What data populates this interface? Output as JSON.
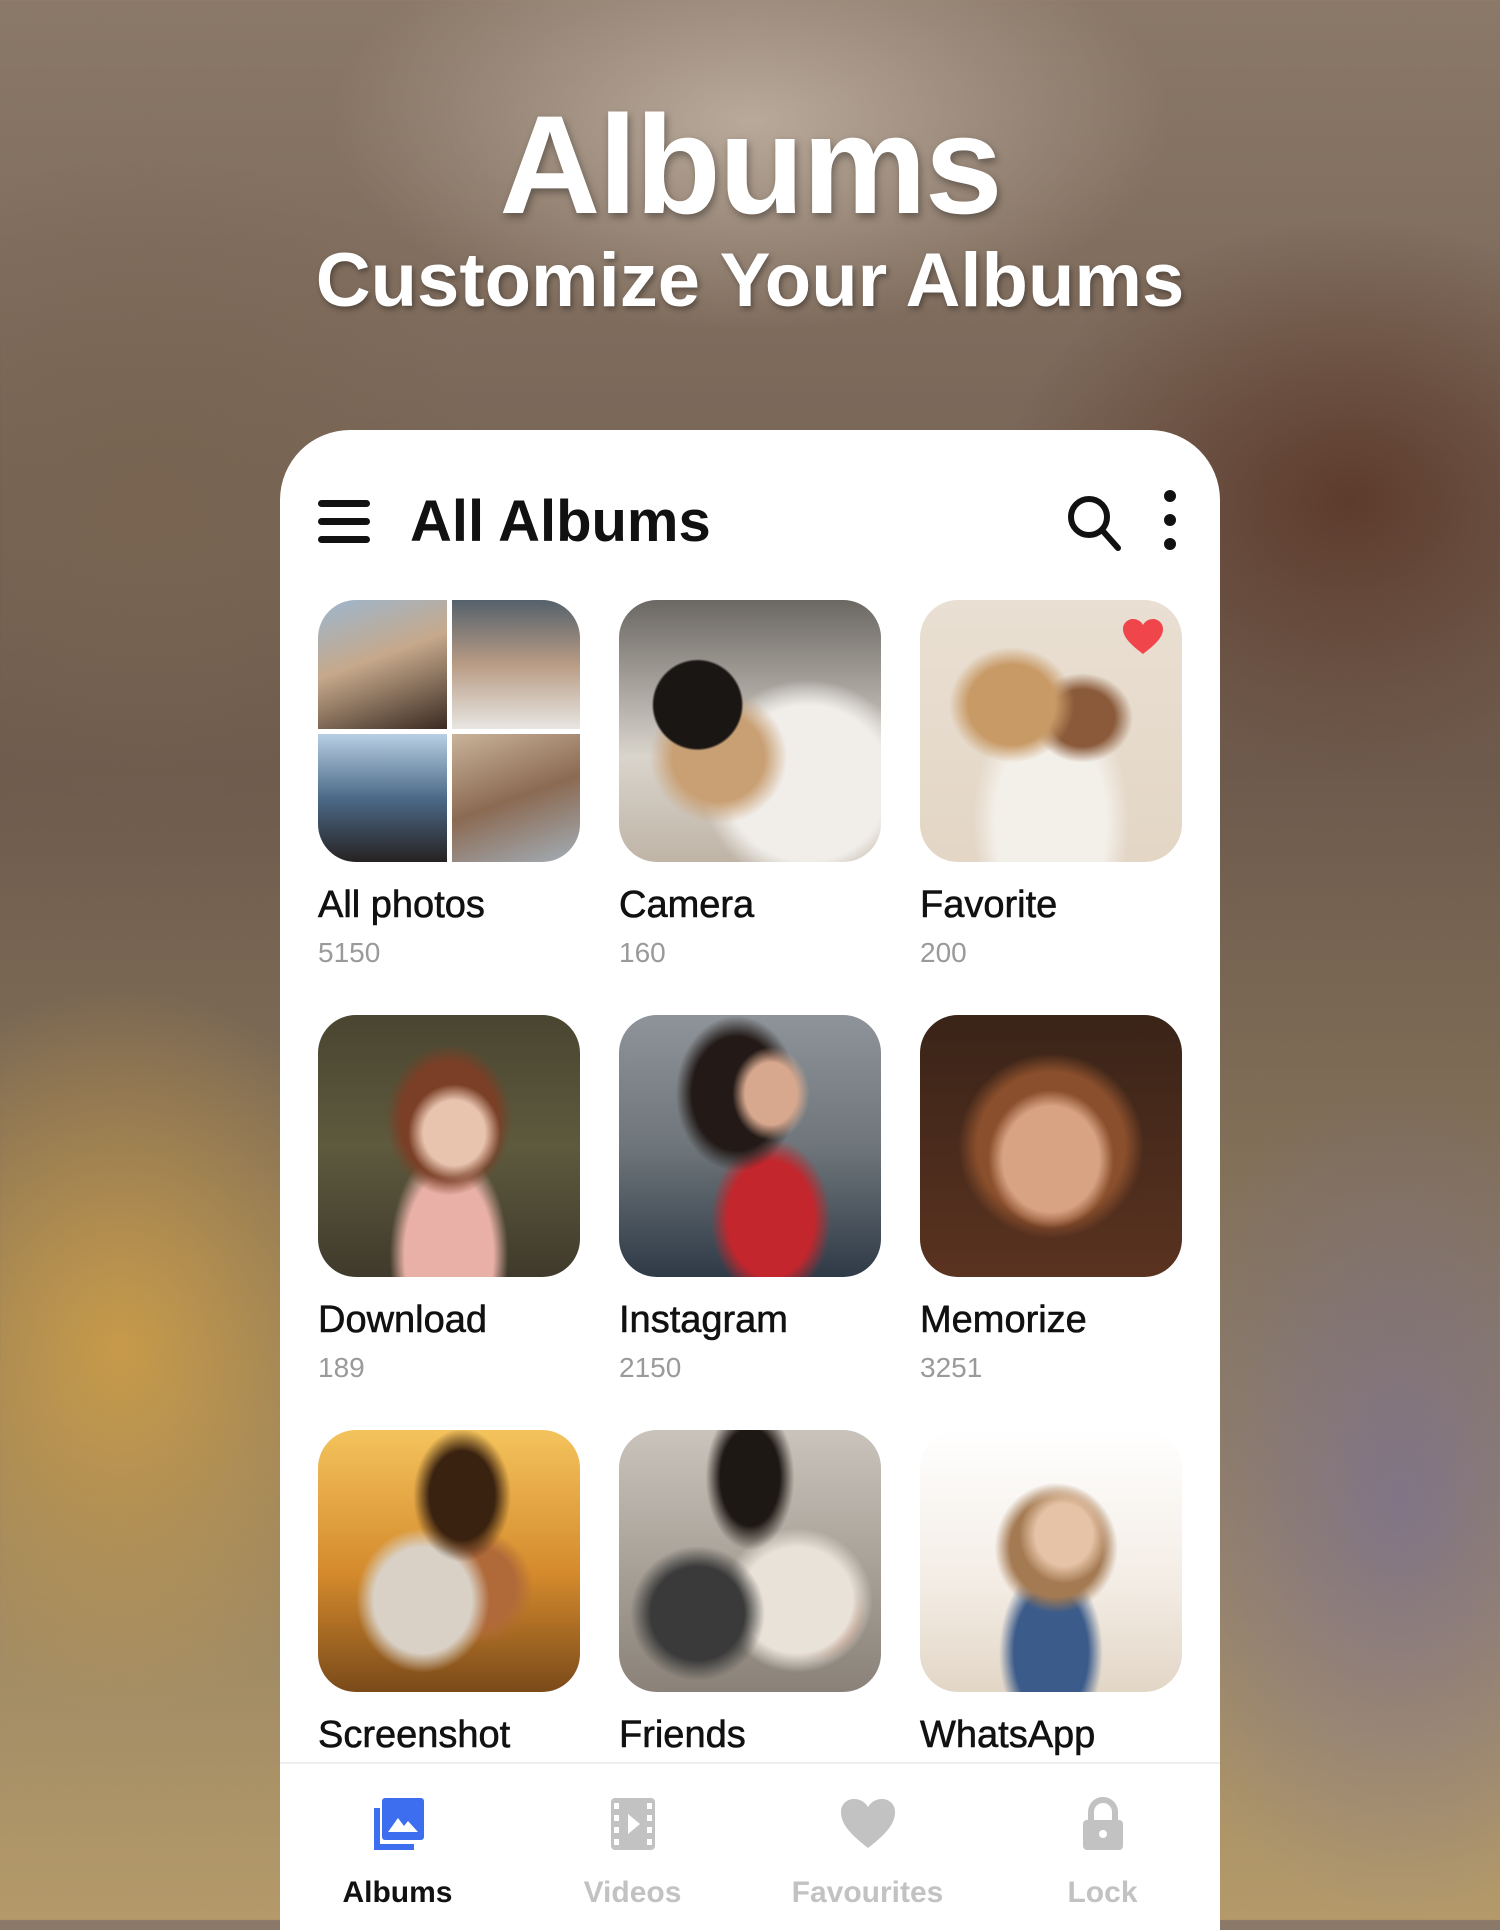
{
  "promo": {
    "headline": "Albums",
    "subheadline": "Customize Your Albums"
  },
  "appbar": {
    "title": "All Albums",
    "menu_icon": "hamburger-menu-icon",
    "search_icon": "search-icon",
    "more_icon": "more-vertical-icon"
  },
  "albums": [
    {
      "name": "All photos",
      "count": "5150",
      "thumb": "collage-of-four-photos"
    },
    {
      "name": "Camera",
      "count": "160",
      "thumb": "couple-woman-in-hat"
    },
    {
      "name": "Favorite",
      "count": "200",
      "thumb": "couple-kissing",
      "badge": "heart-icon"
    },
    {
      "name": "Download",
      "count": "189",
      "thumb": "woman-in-flowers"
    },
    {
      "name": "Instagram",
      "count": "2150",
      "thumb": "woman-red-top"
    },
    {
      "name": "Memorize",
      "count": "3251",
      "thumb": "woman-portrait-smiling"
    },
    {
      "name": "Screenshot",
      "count": "",
      "thumb": "couple-hugging-sunset"
    },
    {
      "name": "Friends",
      "count": "",
      "thumb": "couple-forehead-touch"
    },
    {
      "name": "WhatsApp",
      "count": "",
      "thumb": "woman-beach-selfie"
    }
  ],
  "nav": [
    {
      "label": "Albums",
      "icon": "albums-icon",
      "active": true
    },
    {
      "label": "Videos",
      "icon": "video-film-icon",
      "active": false
    },
    {
      "label": "Favourites",
      "icon": "heart-icon",
      "active": false
    },
    {
      "label": "Lock",
      "icon": "lock-icon",
      "active": false
    }
  ],
  "colors": {
    "accent": "#3d6ef0",
    "heart": "#f0464b",
    "inactive": "#c2c2c2",
    "count_text": "#9a9a9a"
  }
}
